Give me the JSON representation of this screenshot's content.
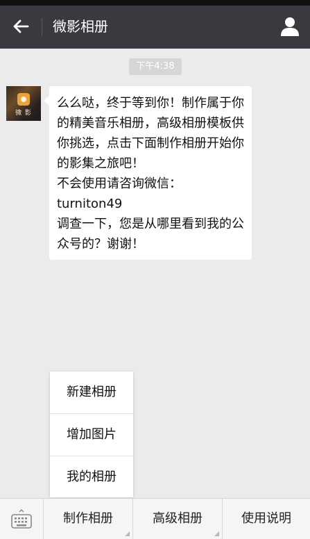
{
  "header": {
    "title": "微影相册",
    "back_icon": "arrow-left-icon",
    "user_icon": "person-icon"
  },
  "chat": {
    "time": "下午4:38",
    "avatar_text": "微 影",
    "message": "么么哒，终于等到你！制作属于你的精美音乐相册，高级相册模板供你挑选，点击下面制作相册开始你的影集之旅吧！\n不会使用请咨询微信：\nturniton49\n调查一下，您是从哪里看到我的公众号的？谢谢！"
  },
  "popup": {
    "items": [
      "新建相册",
      "增加图片",
      "我的相册"
    ]
  },
  "bottom_menu": {
    "keyboard_icon": "keyboard-icon",
    "items": [
      "制作相册",
      "高级相册",
      "使用说明"
    ]
  },
  "colors": {
    "header_bg": "#393a3f",
    "chat_bg": "#ebebeb",
    "bubble_bg": "#ffffff",
    "time_badge_bg": "#d6d6d6"
  }
}
